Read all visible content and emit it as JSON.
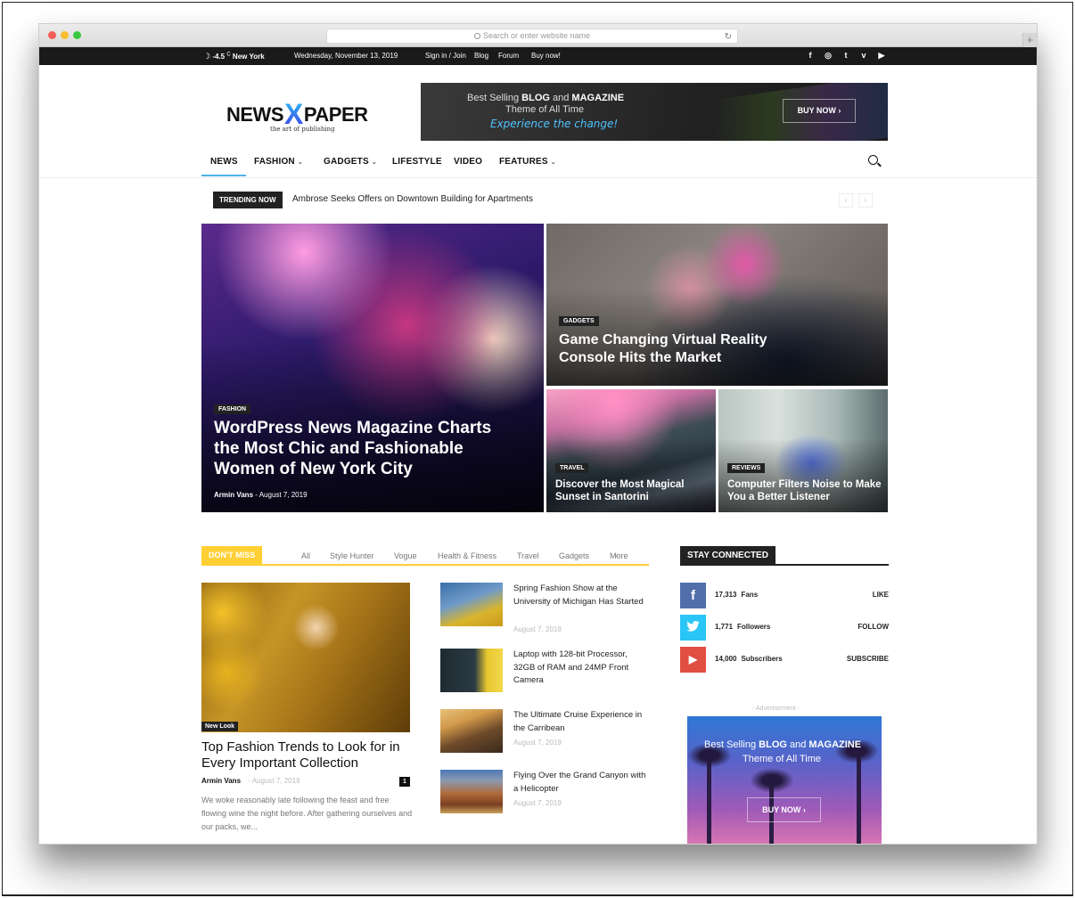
{
  "browser": {
    "url_placeholder": "Search or enter website name",
    "reload_icon": "↻",
    "new_tab_icon": "+"
  },
  "topbar": {
    "weather_icon": "☽",
    "temperature": "-4.5",
    "temp_unit": "C",
    "city": "New York",
    "date": "Wednesday, November 13, 2019",
    "links": [
      "Sign in / Join",
      "Blog",
      "Forum",
      "Buy now!"
    ],
    "social_icons": [
      "f",
      "◎",
      "t",
      "v",
      "▶"
    ]
  },
  "header": {
    "logo_left": "NEWS",
    "logo_x": "X",
    "logo_right": "PAPER",
    "tagline": "the art of publishing",
    "banner": {
      "line1_a": "Best Selling ",
      "line1_b": "BLOG",
      "line1_c": " and ",
      "line1_d": "MAGAZINE",
      "line2": "Theme of All Time",
      "line3": "Experience the change!",
      "button": "BUY NOW ›"
    }
  },
  "nav": {
    "items": [
      {
        "label": "NEWS",
        "dropdown": false
      },
      {
        "label": "FASHION",
        "dropdown": true
      },
      {
        "label": "GADGETS",
        "dropdown": true
      },
      {
        "label": "LIFESTYLE",
        "dropdown": false
      },
      {
        "label": "VIDEO",
        "dropdown": false
      },
      {
        "label": "FEATURES",
        "dropdown": true
      }
    ],
    "chevron": "⌄",
    "active": "NEWS"
  },
  "trending": {
    "label": "TRENDING NOW",
    "headline": "Ambrose Seeks Offers on Downtown Building for Apartments",
    "prev": "‹",
    "next": "›"
  },
  "featured": {
    "main": {
      "category": "FASHION",
      "title": "WordPress News Magazine Charts the Most Chic and Fashionable Women of New York City",
      "author": "Armin Vans",
      "separator": "-",
      "date": "August 7, 2019"
    },
    "top_right": {
      "category": "GADGETS",
      "title": "Game Changing Virtual Reality Console Hits the Market"
    },
    "bottom_left": {
      "category": "TRAVEL",
      "title": "Discover the Most Magical Sunset in Santorini"
    },
    "bottom_right": {
      "category": "REVIEWS",
      "title": "Computer Filters Noise to Make You a Better Listener"
    }
  },
  "dont_miss": {
    "label": "DON'T MISS",
    "filters": [
      "All",
      "Style Hunter",
      "Vogue",
      "Health & Fitness",
      "Travel",
      "Gadgets",
      "More"
    ],
    "more_chevron": "⌄",
    "big_card": {
      "badge": "New Look",
      "title": "Top Fashion Trends to Look for in Every Important Collection",
      "author": "Armin Vans",
      "separator": "-",
      "date": "August 7, 2019",
      "comments": "1",
      "excerpt": "We woke reasonably late following the feast and free flowing wine the night before. After gathering ourselves and our packs, we..."
    },
    "list": [
      {
        "title": "Spring Fashion Show at the University of Michigan Has Started",
        "date": "August 7, 2019"
      },
      {
        "title": "Laptop with 128-bit Processor, 32GB of RAM and 24MP Front Camera",
        "date": ""
      },
      {
        "title": "The Ultimate Cruise Experience in the Carribean",
        "date": "August 7, 2019"
      },
      {
        "title": "Flying Over the Grand Canyon with a Helicopter",
        "date": "August 7, 2019"
      }
    ]
  },
  "stay_connected": {
    "label": "STAY CONNECTED",
    "rows": [
      {
        "network": "facebook",
        "icon": "f",
        "count": "17,313",
        "unit": "Fans",
        "action": "LIKE",
        "color": "#516eab"
      },
      {
        "network": "twitter",
        "icon": "🐦",
        "count": "1,771",
        "unit": "Followers",
        "action": "FOLLOW",
        "color": "#29c5f6"
      },
      {
        "network": "youtube",
        "icon": "▶",
        "count": "14,000",
        "unit": "Subscribers",
        "action": "SUBSCRIBE",
        "color": "#e14e42"
      }
    ]
  },
  "advertisement": {
    "label": "- Advertisement -",
    "line1_a": "Best Selling ",
    "line1_b": "BLOG",
    "line1_c": " and ",
    "line1_d": "MAGAZINE",
    "line2": "Theme of All Time",
    "button": "BUY NOW ›"
  },
  "colors": {
    "accent_blue": "#4db2ec",
    "dont_miss_yellow": "#ffd034",
    "dark": "#222222"
  }
}
